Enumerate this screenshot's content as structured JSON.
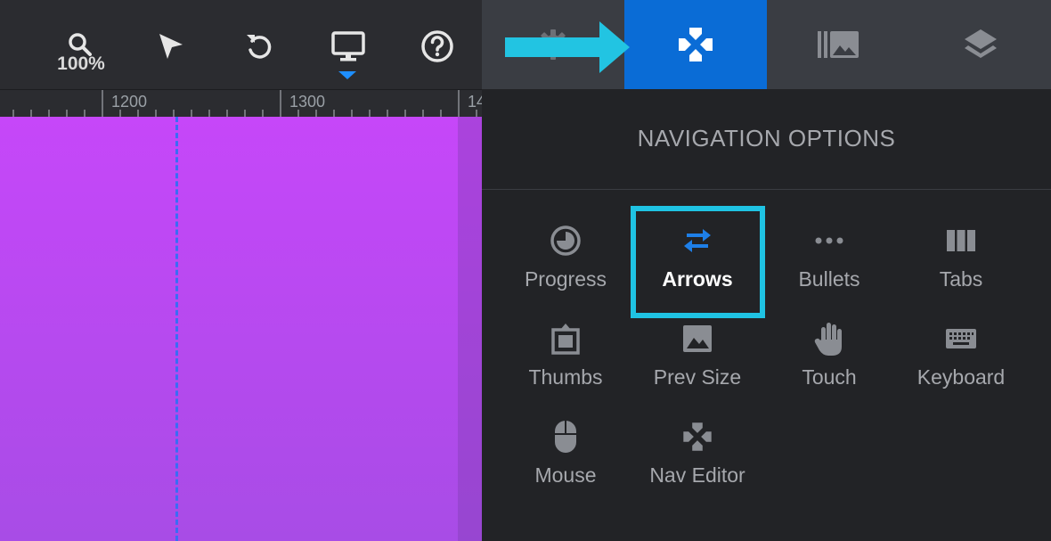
{
  "toolbar": {
    "zoom_label": "100%",
    "tools": [
      {
        "name": "zoom",
        "icon": "search-icon"
      },
      {
        "name": "select",
        "icon": "cursor-arrow-icon"
      },
      {
        "name": "undo",
        "icon": "undo-icon"
      },
      {
        "name": "device",
        "icon": "desktop-monitor-icon"
      },
      {
        "name": "help",
        "icon": "help-icon"
      }
    ]
  },
  "ruler": {
    "labels": [
      "1200",
      "1300",
      "14"
    ]
  },
  "panel_tabs": [
    {
      "name": "settings",
      "icon": "gear-icon"
    },
    {
      "name": "navigation",
      "icon": "gamepad-icon",
      "active": true
    },
    {
      "name": "media",
      "icon": "image-library-icon"
    },
    {
      "name": "layers",
      "icon": "layers-icon"
    }
  ],
  "panel": {
    "title": "NAVIGATION OPTIONS",
    "options": [
      {
        "label": "Progress",
        "icon": "progress-icon"
      },
      {
        "label": "Arrows",
        "icon": "arrows-swap-icon",
        "active": true
      },
      {
        "label": "Bullets",
        "icon": "bullets-icon"
      },
      {
        "label": "Tabs",
        "icon": "tabs-icon"
      },
      {
        "label": "Thumbs",
        "icon": "thumbs-icon"
      },
      {
        "label": "Prev Size",
        "icon": "image-icon"
      },
      {
        "label": "Touch",
        "icon": "hand-icon"
      },
      {
        "label": "Keyboard",
        "icon": "keyboard-icon"
      },
      {
        "label": "Mouse",
        "icon": "mouse-icon"
      },
      {
        "label": "Nav Editor",
        "icon": "gamepad-icon"
      }
    ]
  },
  "colors": {
    "accent_blue": "#0a6cd6",
    "highlight_cyan": "#1fc3e3",
    "canvas_top": "#c647f9",
    "canvas_bottom": "#a84ce6",
    "guide_line": "#3a6cf5"
  }
}
